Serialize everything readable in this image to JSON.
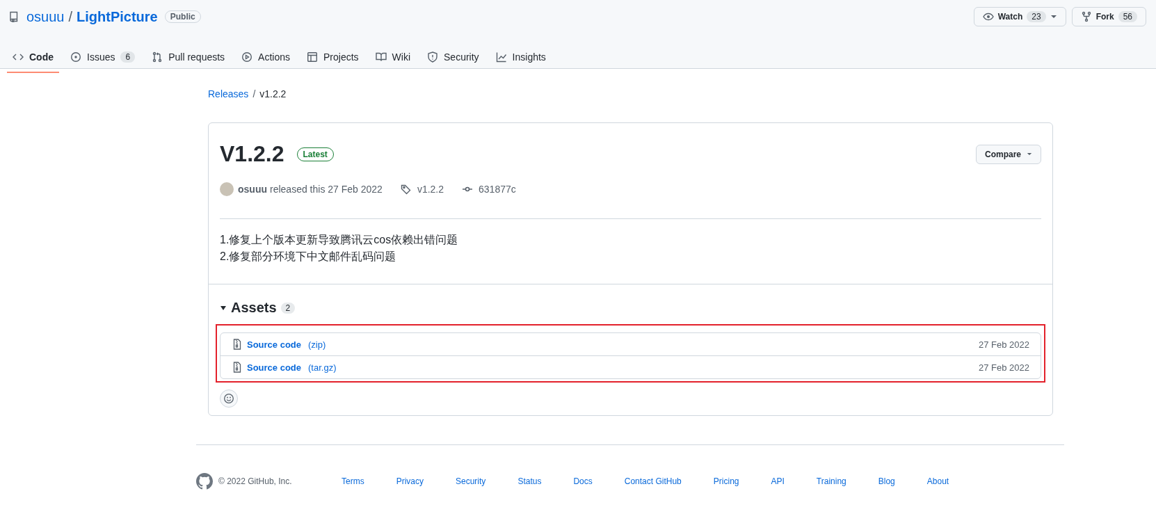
{
  "repo": {
    "owner": "osuuu",
    "separator": "/",
    "name": "LightPicture",
    "visibility": "Public"
  },
  "actions": [
    {
      "label": "Watch",
      "count": "23",
      "kind": "watch"
    },
    {
      "label": "Fork",
      "count": "56",
      "kind": "fork"
    }
  ],
  "tabs": [
    {
      "label": "Code",
      "kind": "code",
      "selected": true
    },
    {
      "label": "Issues",
      "kind": "issue",
      "count": "6",
      "selected": false
    },
    {
      "label": "Pull requests",
      "kind": "pr",
      "selected": false
    },
    {
      "label": "Actions",
      "kind": "play",
      "selected": false
    },
    {
      "label": "Projects",
      "kind": "table",
      "selected": false
    },
    {
      "label": "Wiki",
      "kind": "book",
      "selected": false
    },
    {
      "label": "Security",
      "kind": "shield",
      "selected": false
    },
    {
      "label": "Insights",
      "kind": "graph",
      "selected": false
    }
  ],
  "breadcrumb": {
    "parent": "Releases",
    "separator": "/",
    "current": "v1.2.2"
  },
  "release": {
    "title": "V1.2.2",
    "badge": "Latest",
    "compare": "Compare",
    "author": "osuuu",
    "released": "released this 27 Feb 2022",
    "tag": "v1.2.2",
    "commit": "631877c",
    "notes": [
      "1.修复上个版本更新导致腾讯云cos依赖出错问题",
      "2.修复部分环境下中文邮件乱码问题"
    ],
    "assets": {
      "title": "Assets",
      "count": "2",
      "expanded": true,
      "items": [
        {
          "name": "Source code",
          "format": "(zip)",
          "date": "27 Feb 2022"
        },
        {
          "name": "Source code",
          "format": "(tar.gz)",
          "date": "27 Feb 2022"
        }
      ]
    }
  },
  "footer": {
    "copyright": "© 2022 GitHub, Inc.",
    "links": [
      "Terms",
      "Privacy",
      "Security",
      "Status",
      "Docs",
      "Contact GitHub",
      "Pricing",
      "API",
      "Training",
      "Blog",
      "About"
    ]
  }
}
